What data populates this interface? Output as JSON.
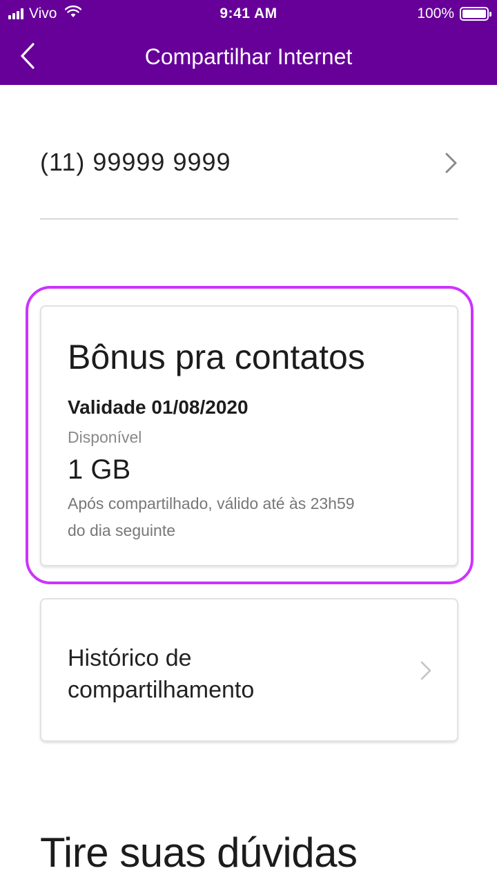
{
  "status_bar": {
    "carrier": "Vivo",
    "time": "9:41 AM",
    "battery": "100%"
  },
  "header": {
    "title": "Compartilhar Internet",
    "back_icon": "chevron-left-icon"
  },
  "phone": {
    "number": "(11) 99999 9999",
    "chevron_icon": "chevron-right-icon"
  },
  "bonus_card": {
    "title": "Bônus pra contatos",
    "validity": "Validade 01/08/2020",
    "available_label": "Disponível",
    "amount": "1 GB",
    "note": "Após compartilhado, válido até às 23h59 do dia seguinte"
  },
  "history_card": {
    "label": "Histórico de compartilhamento",
    "chevron_icon": "chevron-right-icon"
  },
  "faq": {
    "title": "Tire suas dúvidas"
  },
  "colors": {
    "brand_purple": "#660099",
    "highlight": "#cc33ff",
    "divider": "#d8d8d8"
  }
}
